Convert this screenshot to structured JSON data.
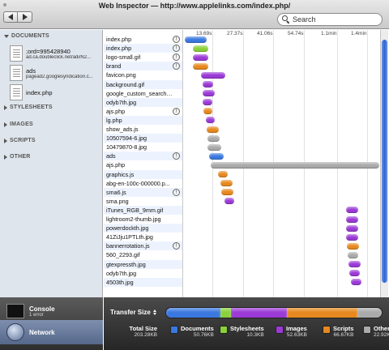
{
  "window": {
    "title": "Web Inspector — http://www.applelinks.com/index.php/"
  },
  "search": {
    "placeholder": "Search"
  },
  "sidebar": {
    "sections": [
      {
        "label": "DOCUMENTS",
        "expanded": true
      },
      {
        "label": "STYLESHEETS",
        "expanded": false
      },
      {
        "label": "IMAGES",
        "expanded": false
      },
      {
        "label": "SCRIPTS",
        "expanded": false
      },
      {
        "label": "OTHER",
        "expanded": false
      }
    ],
    "documents": [
      {
        "name": ";ord=995428940",
        "sub": "ad.ca.doubleclick.net/adi/N2..."
      },
      {
        "name": "ads",
        "sub": "pagead2.googlesyndication.c..."
      },
      {
        "name": "index.php",
        "sub": ""
      }
    ],
    "console": {
      "title": "Console",
      "sub": "1 error"
    },
    "network": {
      "label": "Network"
    }
  },
  "timeline": {
    "ticks": [
      "13.69s",
      "27.37s",
      "41.06s",
      "54.74s",
      "1.1min",
      "1.4min"
    ]
  },
  "resources": [
    {
      "name": "index.php",
      "warn": true,
      "start": 0.005,
      "end": 0.115,
      "color": "#3a78e0"
    },
    {
      "name": "index.php",
      "warn": true,
      "start": 0.045,
      "end": 0.125,
      "color": "#8ad13a"
    },
    {
      "name": "logo-small.gif",
      "warn": true,
      "start": 0.045,
      "end": 0.125,
      "color": "#9b3ad6"
    },
    {
      "name": "brand",
      "warn": true,
      "start": 0.045,
      "end": 0.125,
      "color": "#e7891e"
    },
    {
      "name": "favicon.png",
      "warn": false,
      "start": 0.085,
      "end": 0.21,
      "color": "#9b3ad6"
    },
    {
      "name": "background.gif",
      "warn": false,
      "start": 0.095,
      "end": 0.15,
      "color": "#9b3ad6"
    },
    {
      "name": "google_custom_search_...",
      "warn": false,
      "start": 0.095,
      "end": 0.155,
      "color": "#9b3ad6"
    },
    {
      "name": "odyb7th.jpg",
      "warn": false,
      "start": 0.095,
      "end": 0.145,
      "color": "#9b3ad6"
    },
    {
      "name": "ajs.php",
      "warn": true,
      "start": 0.1,
      "end": 0.145,
      "color": "#e7891e"
    },
    {
      "name": "lg.php",
      "warn": false,
      "start": 0.11,
      "end": 0.155,
      "color": "#9b3ad6"
    },
    {
      "name": "show_ads.js",
      "warn": false,
      "start": 0.115,
      "end": 0.175,
      "color": "#e7891e"
    },
    {
      "name": "10507594-6.jpg",
      "warn": false,
      "start": 0.12,
      "end": 0.18,
      "color": "#aaaaaa"
    },
    {
      "name": "10479870-8.jpg",
      "warn": false,
      "start": 0.12,
      "end": 0.19,
      "color": "#aaaaaa"
    },
    {
      "name": "ads",
      "warn": true,
      "start": 0.13,
      "end": 0.205,
      "color": "#3a78e0"
    },
    {
      "name": "ajs.php",
      "warn": false,
      "start": 0.135,
      "end": 0.995,
      "color": "#aaaaaa"
    },
    {
      "name": "graphics.js",
      "warn": false,
      "start": 0.175,
      "end": 0.225,
      "color": "#e7891e"
    },
    {
      "name": "abg-en-100c-000000.p...",
      "warn": false,
      "start": 0.185,
      "end": 0.245,
      "color": "#e7891e"
    },
    {
      "name": "sma6.js",
      "warn": true,
      "start": 0.19,
      "end": 0.25,
      "color": "#e7891e"
    },
    {
      "name": "sma.png",
      "warn": false,
      "start": 0.205,
      "end": 0.255,
      "color": "#9b3ad6"
    },
    {
      "name": "iTunes_RGB_9mm.gif",
      "warn": false,
      "start": 0.825,
      "end": 0.885,
      "color": "#9b3ad6"
    },
    {
      "name": "lightroom2-thumb.jpg",
      "warn": false,
      "start": 0.825,
      "end": 0.885,
      "color": "#9b3ad6"
    },
    {
      "name": "powerdockth.jpg",
      "warn": false,
      "start": 0.825,
      "end": 0.885,
      "color": "#9b3ad6"
    },
    {
      "name": "41ZiJju1PTLth.jpg",
      "warn": false,
      "start": 0.825,
      "end": 0.885,
      "color": "#9b3ad6"
    },
    {
      "name": "bannerrotation.js",
      "warn": true,
      "start": 0.83,
      "end": 0.89,
      "color": "#e7891e"
    },
    {
      "name": "560_2293.gif",
      "warn": false,
      "start": 0.835,
      "end": 0.89,
      "color": "#aaaaaa"
    },
    {
      "name": "gtexpressth.jpg",
      "warn": false,
      "start": 0.84,
      "end": 0.9,
      "color": "#9b3ad6"
    },
    {
      "name": "odyb7th.jpg",
      "warn": false,
      "start": 0.845,
      "end": 0.9,
      "color": "#9b3ad6"
    },
    {
      "name": "4503th.jpg",
      "warn": false,
      "start": 0.85,
      "end": 0.905,
      "color": "#9b3ad6"
    }
  ],
  "summary": {
    "transfer_label": "Transfer Size",
    "total": {
      "label": "Total Size",
      "value": "203.28KB"
    },
    "categories": [
      {
        "label": "Documents",
        "value": "50.76KB",
        "color": "#3a78e0",
        "fraction": 0.25
      },
      {
        "label": "Stylesheets",
        "value": "10.3KB",
        "color": "#8ad13a",
        "fraction": 0.05
      },
      {
        "label": "Images",
        "value": "52.63KB",
        "color": "#9b3ad6",
        "fraction": 0.259
      },
      {
        "label": "Scripts",
        "value": "66.67KB",
        "color": "#e7891e",
        "fraction": 0.328
      },
      {
        "label": "Other",
        "value": "22.92KB",
        "color": "#aaaaaa",
        "fraction": 0.113
      }
    ]
  }
}
